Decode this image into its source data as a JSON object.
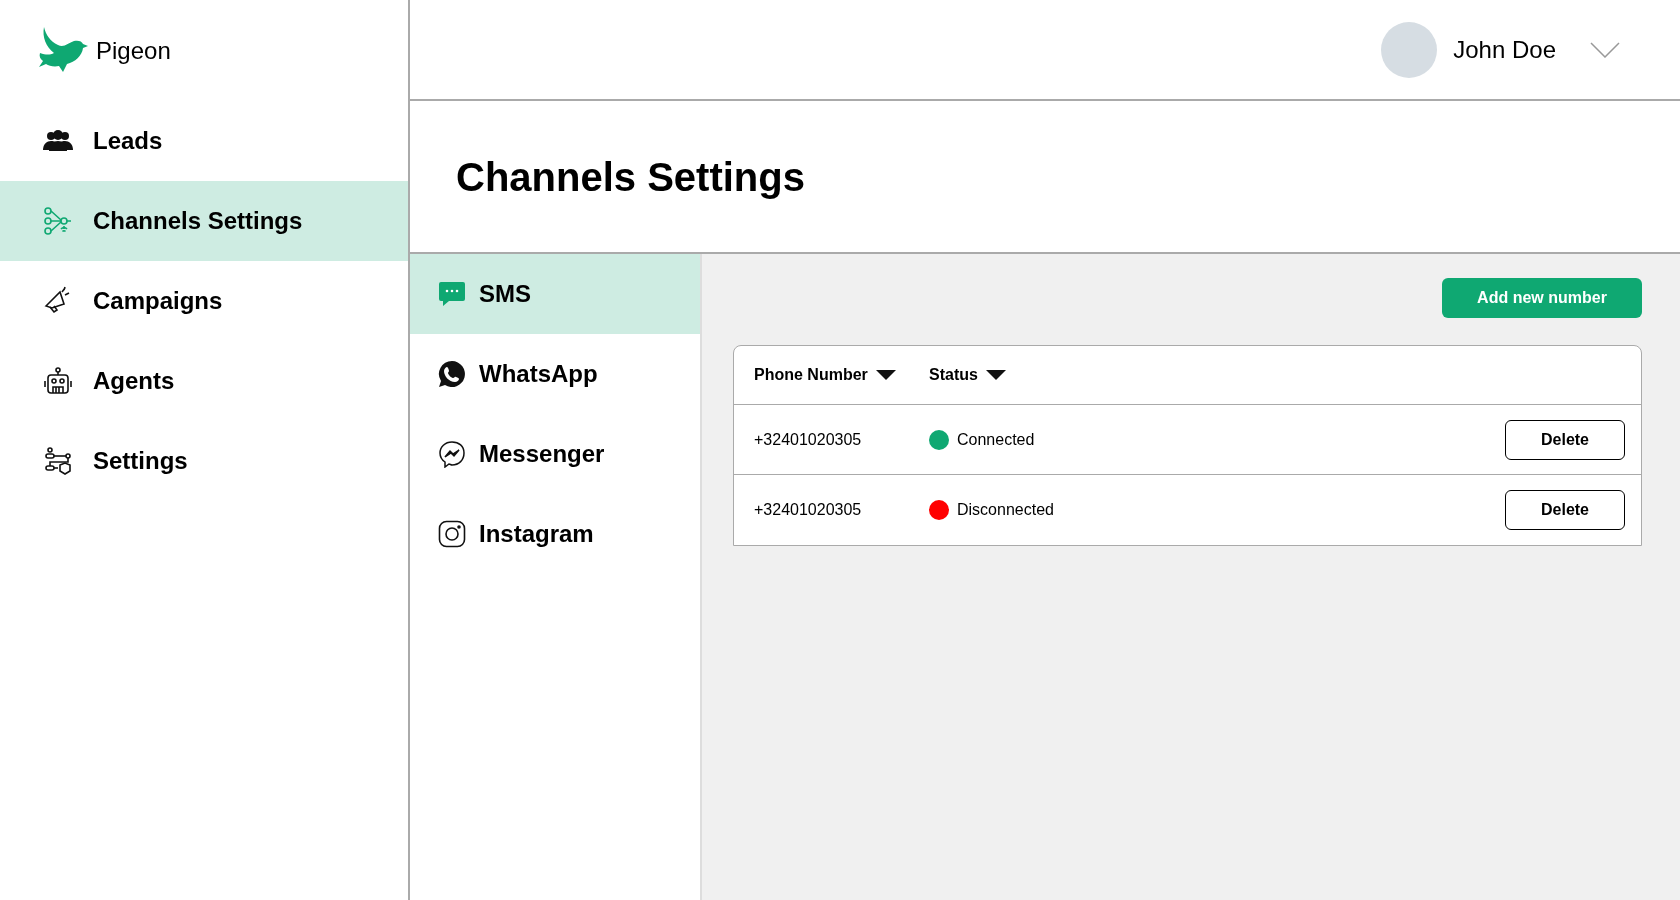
{
  "brand": {
    "name": "Pigeon"
  },
  "user": {
    "name": "John Doe"
  },
  "sidebar": {
    "items": [
      {
        "label": "Leads",
        "selected": false
      },
      {
        "label": "Channels Settings",
        "selected": true
      },
      {
        "label": "Campaigns",
        "selected": false
      },
      {
        "label": "Agents",
        "selected": false
      },
      {
        "label": "Settings",
        "selected": false
      }
    ]
  },
  "page_title": "Channels Settings",
  "channels": [
    {
      "label": "SMS",
      "selected": true
    },
    {
      "label": "WhatsApp",
      "selected": false
    },
    {
      "label": "Messenger",
      "selected": false
    },
    {
      "label": "Instagram",
      "selected": false
    }
  ],
  "add_button": "Add new number",
  "table": {
    "columns": [
      "Phone Number",
      "Status"
    ],
    "rows": [
      {
        "phone": "+32401020305",
        "status": "Connected",
        "color": "#0fa872",
        "action": "Delete"
      },
      {
        "phone": "+32401020305",
        "status": "Disconnected",
        "color": "#ff0000",
        "action": "Delete"
      }
    ]
  }
}
